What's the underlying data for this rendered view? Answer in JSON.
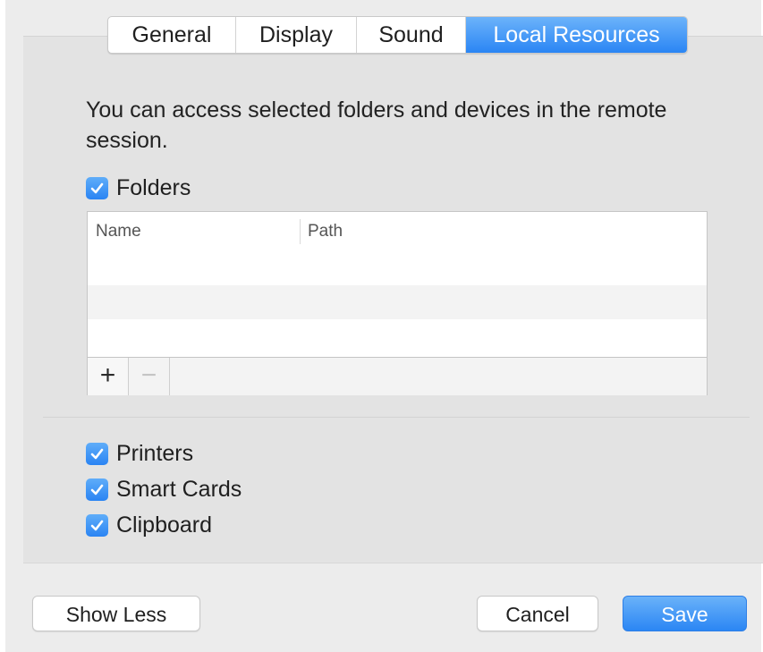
{
  "tabs": [
    {
      "label": "General",
      "active": false
    },
    {
      "label": "Display",
      "active": false
    },
    {
      "label": "Sound",
      "active": false
    },
    {
      "label": "Local Resources",
      "active": true
    }
  ],
  "description": "You can access selected folders and devices in the remote session.",
  "folders": {
    "label": "Folders",
    "checked": true,
    "table": {
      "columns": [
        "Name",
        "Path"
      ],
      "rows": []
    },
    "add_label": "+",
    "remove_label": "−"
  },
  "options": [
    {
      "label": "Printers",
      "checked": true
    },
    {
      "label": "Smart Cards",
      "checked": true
    },
    {
      "label": "Clipboard",
      "checked": true
    }
  ],
  "buttons": {
    "show_less": "Show Less",
    "cancel": "Cancel",
    "save": "Save"
  },
  "colors": {
    "accent": "#2a85f4",
    "panel_bg": "#e3e3e3",
    "window_bg": "#ececec"
  },
  "icons": {
    "checkbox": "checkmark-icon",
    "add": "plus-icon",
    "remove": "minus-icon"
  }
}
